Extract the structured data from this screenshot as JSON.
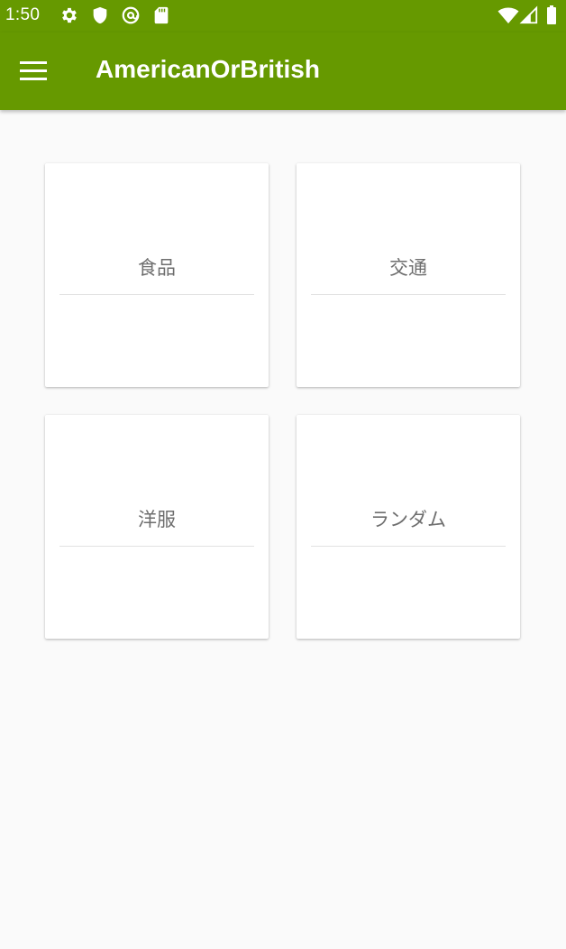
{
  "status_bar": {
    "time": "1:50",
    "left_icons": [
      "settings-icon",
      "shield-icon",
      "at-sign-icon",
      "sd-card-icon"
    ],
    "right_icons": [
      "wifi-icon",
      "cell-signal-icon",
      "battery-icon"
    ]
  },
  "toolbar": {
    "title": "AmericanOrBritish",
    "background_color": "#669900",
    "menu_icon": "hamburger-menu-icon"
  },
  "categories": [
    {
      "label": "食品"
    },
    {
      "label": "交通"
    },
    {
      "label": "洋服"
    },
    {
      "label": "ランダム"
    }
  ]
}
